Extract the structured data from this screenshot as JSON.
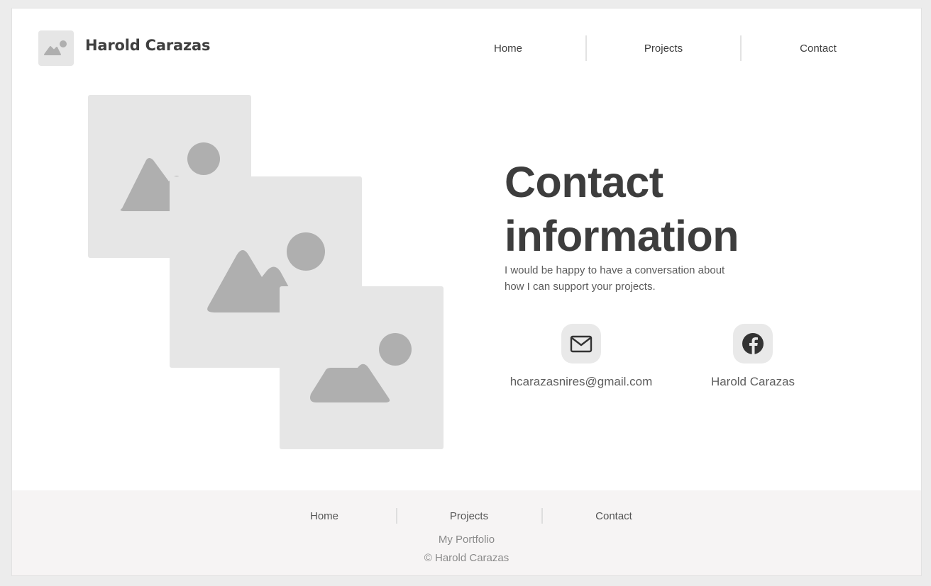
{
  "header": {
    "logo_icon": "image-placeholder-icon",
    "brand": "Harold Carazas",
    "nav": [
      {
        "label": "Home"
      },
      {
        "label": "Projects"
      },
      {
        "label": "Contact"
      }
    ]
  },
  "gallery": {
    "images": [
      {
        "icon": "image-placeholder-icon"
      },
      {
        "icon": "image-placeholder-icon"
      },
      {
        "icon": "image-placeholder-icon"
      }
    ]
  },
  "contact": {
    "title_line1": "Contact",
    "title_line2": "information",
    "lead_line1": "I would be happy to have a conversation about",
    "lead_line2": "how I can support your projects.",
    "email": {
      "icon": "mail-icon",
      "label": "hcarazasnires@gmail.com"
    },
    "facebook": {
      "icon": "facebook-icon",
      "label": "Harold Carazas"
    }
  },
  "footer": {
    "nav": [
      {
        "label": "Home"
      },
      {
        "label": "Projects"
      },
      {
        "label": "Contact"
      }
    ],
    "site_name": "My Portfolio",
    "copyright": "© Harold Carazas"
  },
  "colors": {
    "text_dark": "#3d3d3d",
    "placeholder_bg": "#e6e6e6",
    "placeholder_shape": "#afafaf",
    "footer_bg": "#f6f4f4"
  }
}
